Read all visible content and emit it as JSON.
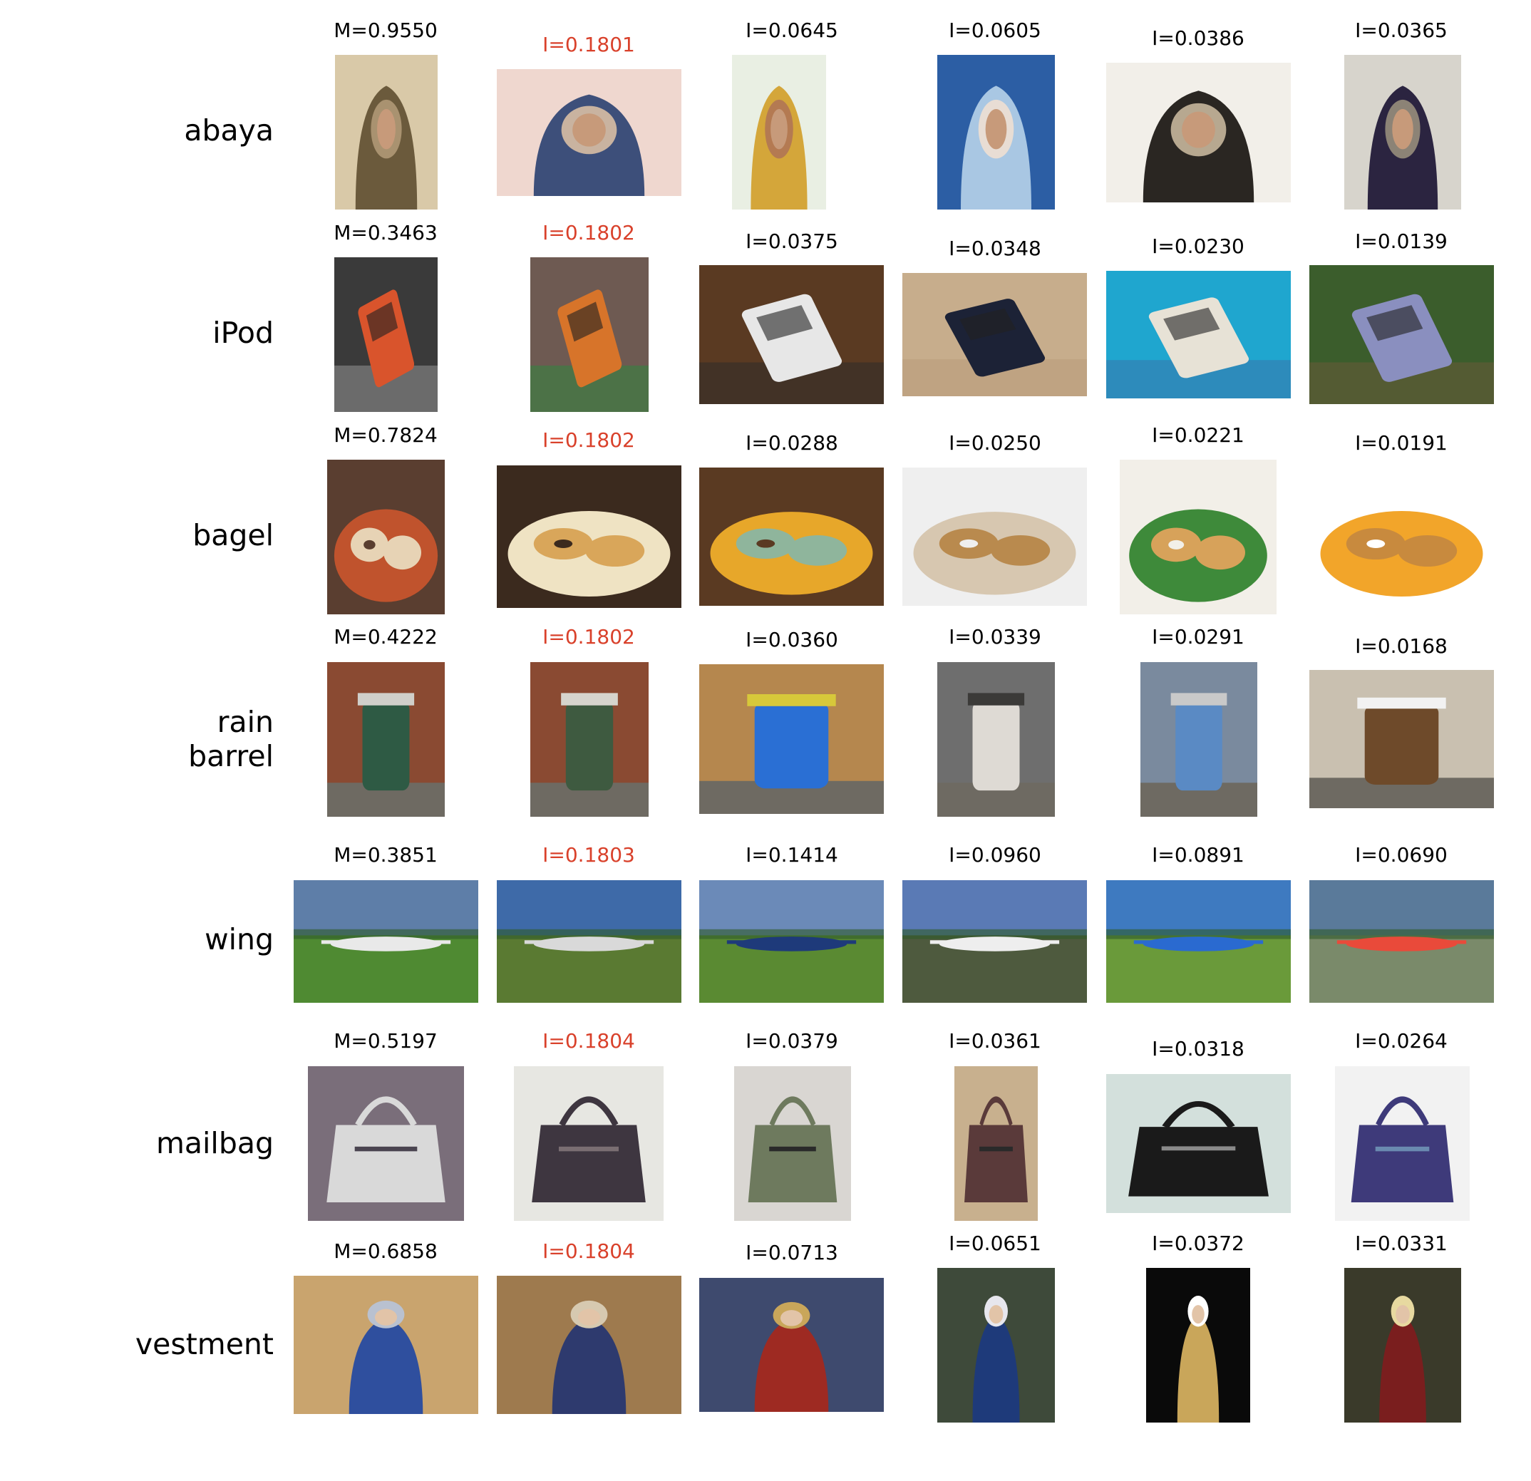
{
  "colors": {
    "text": "#000000",
    "highlight": "#d9412b"
  },
  "rows": [
    {
      "label": [
        "abaya"
      ],
      "scene": "veil",
      "cells": [
        {
          "score": "M=0.9550",
          "highlight": false
        },
        {
          "score": "I=0.1801",
          "highlight": true
        },
        {
          "score": "I=0.0645",
          "highlight": false
        },
        {
          "score": "I=0.0605",
          "highlight": false
        },
        {
          "score": "I=0.0386",
          "highlight": false
        },
        {
          "score": "I=0.0365",
          "highlight": false
        }
      ]
    },
    {
      "label": [
        "iPod"
      ],
      "scene": "device",
      "cells": [
        {
          "score": "M=0.3463",
          "highlight": false
        },
        {
          "score": "I=0.1802",
          "highlight": true
        },
        {
          "score": "I=0.0375",
          "highlight": false
        },
        {
          "score": "I=0.0348",
          "highlight": false
        },
        {
          "score": "I=0.0230",
          "highlight": false
        },
        {
          "score": "I=0.0139",
          "highlight": false
        }
      ]
    },
    {
      "label": [
        "bagel"
      ],
      "scene": "food",
      "cells": [
        {
          "score": "M=0.7824",
          "highlight": false
        },
        {
          "score": "I=0.1802",
          "highlight": true
        },
        {
          "score": "I=0.0288",
          "highlight": false
        },
        {
          "score": "I=0.0250",
          "highlight": false
        },
        {
          "score": "I=0.0221",
          "highlight": false
        },
        {
          "score": "I=0.0191",
          "highlight": false
        }
      ]
    },
    {
      "label": [
        "rain",
        "barrel"
      ],
      "scene": "barrel",
      "cells": [
        {
          "score": "M=0.4222",
          "highlight": false
        },
        {
          "score": "I=0.1802",
          "highlight": true
        },
        {
          "score": "I=0.0360",
          "highlight": false
        },
        {
          "score": "I=0.0339",
          "highlight": false
        },
        {
          "score": "I=0.0291",
          "highlight": false
        },
        {
          "score": "I=0.0168",
          "highlight": false
        }
      ]
    },
    {
      "label": [
        "wing"
      ],
      "scene": "plane",
      "cells": [
        {
          "score": "M=0.3851",
          "highlight": false
        },
        {
          "score": "I=0.1803",
          "highlight": true
        },
        {
          "score": "I=0.1414",
          "highlight": false
        },
        {
          "score": "I=0.0960",
          "highlight": false
        },
        {
          "score": "I=0.0891",
          "highlight": false
        },
        {
          "score": "I=0.0690",
          "highlight": false
        }
      ]
    },
    {
      "label": [
        "mailbag"
      ],
      "scene": "bag",
      "cells": [
        {
          "score": "M=0.5197",
          "highlight": false
        },
        {
          "score": "I=0.1804",
          "highlight": true
        },
        {
          "score": "I=0.0379",
          "highlight": false
        },
        {
          "score": "I=0.0361",
          "highlight": false
        },
        {
          "score": "I=0.0318",
          "highlight": false
        },
        {
          "score": "I=0.0264",
          "highlight": false
        }
      ]
    },
    {
      "label": [
        "vestment"
      ],
      "scene": "statue",
      "cells": [
        {
          "score": "M=0.6858",
          "highlight": false
        },
        {
          "score": "I=0.1804",
          "highlight": true
        },
        {
          "score": "I=0.0713",
          "highlight": false
        },
        {
          "score": "I=0.0651",
          "highlight": false
        },
        {
          "score": "I=0.0372",
          "highlight": false
        },
        {
          "score": "I=0.0331",
          "highlight": false
        }
      ]
    }
  ]
}
